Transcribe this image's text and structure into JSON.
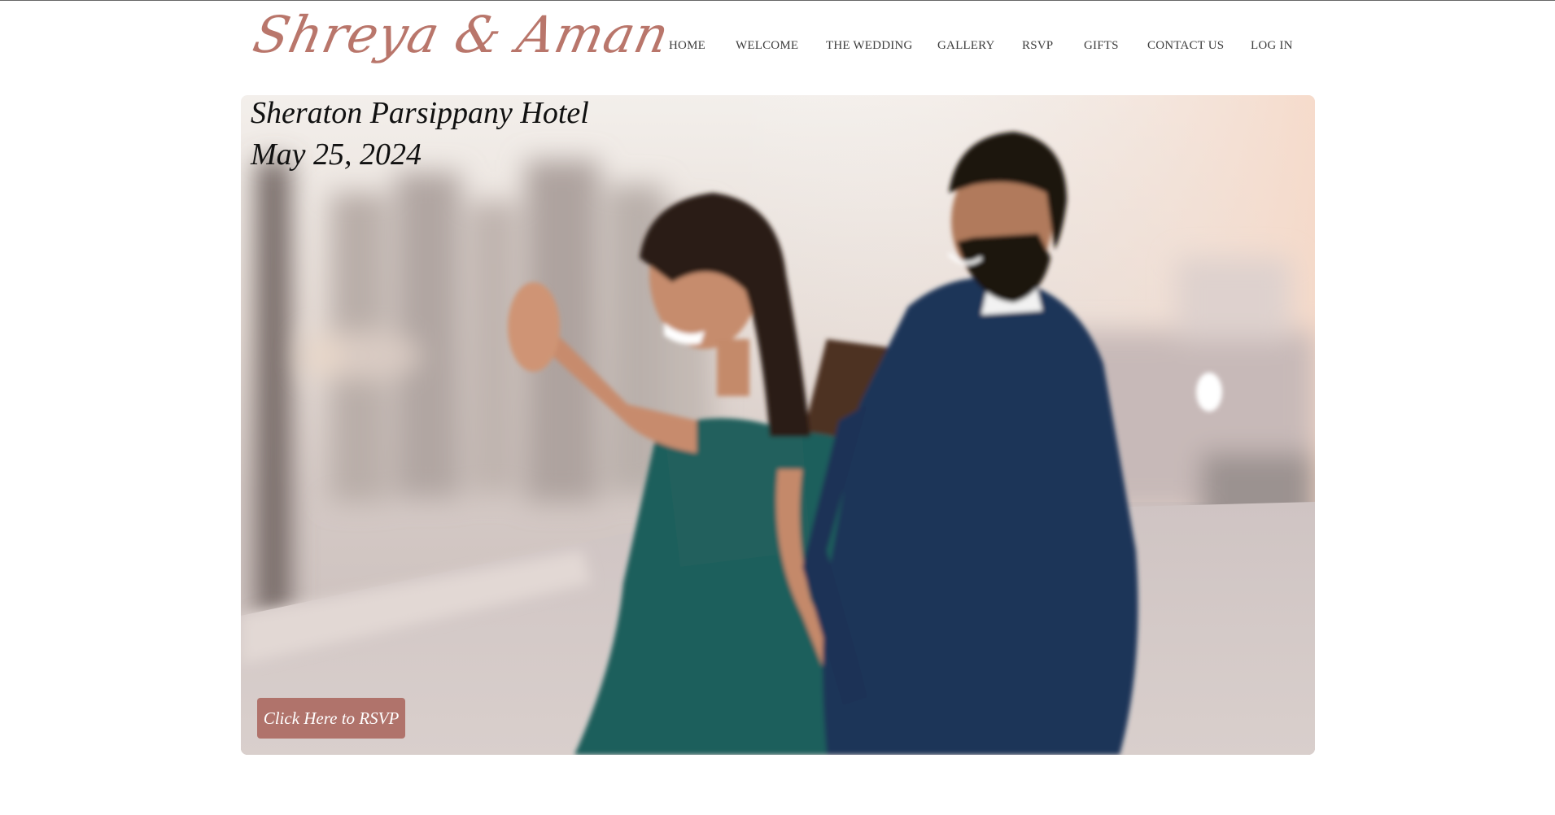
{
  "site": {
    "logo_text": "Shreya & Aman"
  },
  "nav": {
    "items": [
      "HOME",
      "WELCOME",
      "THE WEDDING",
      "GALLERY",
      "RSVP",
      "GIFTS",
      "CONTACT US",
      "LOG IN"
    ]
  },
  "hero": {
    "venue": "Sheraton Parsippany Hotel",
    "date": "May 25, 2024",
    "rsvp_button": "Click Here to RSVP",
    "photo": "engagement-photo"
  },
  "colors": {
    "accent": "#b0736b",
    "logo": "#b9766b",
    "nav_text": "#3d3d3d",
    "heading_text": "#111111"
  }
}
